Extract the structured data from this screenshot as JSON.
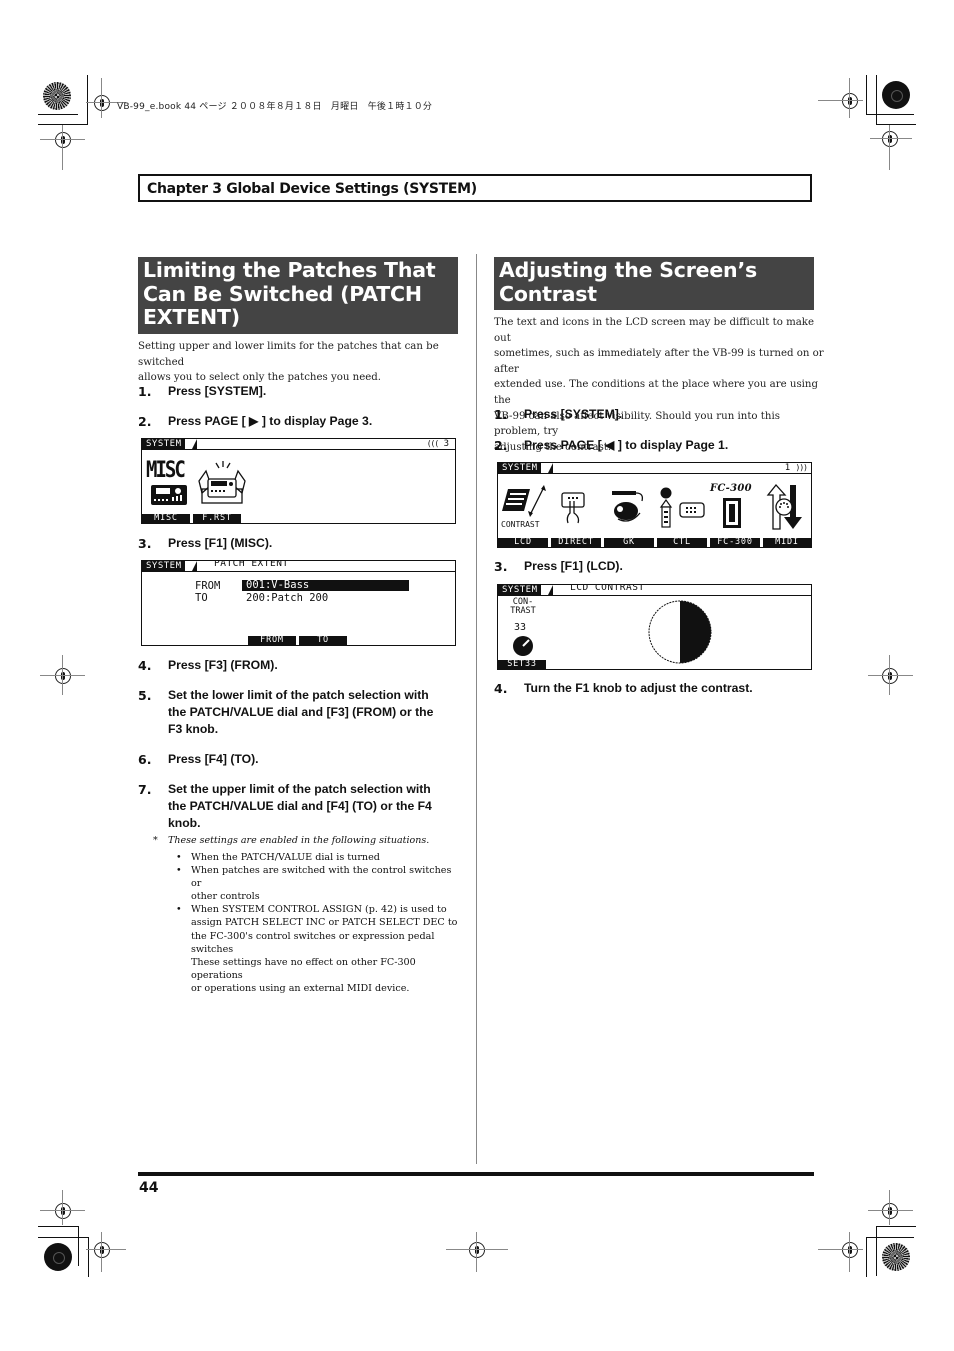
{
  "print_header": "VB-99_e.book  44 ページ  ２００８年８月１８日　月曜日　午後１時１０分",
  "chapter": {
    "title": "Chapter 3 Global Device Settings (SYSTEM)"
  },
  "left_section": {
    "title_lines": [
      "Limiting the Patches That",
      "Can Be Switched (PATCH",
      "EXTENT)"
    ],
    "intro_lines": [
      "Setting upper and lower limits for the patches that can be switched",
      "allows you to select only the patches you need."
    ],
    "steps": [
      {
        "num": "1.",
        "lines": [
          "Press [SYSTEM]."
        ]
      },
      {
        "num": "2.",
        "lines": [
          "Press PAGE [ ▶ ] to display Page 3."
        ]
      },
      {
        "num": "3.",
        "lines": [
          "Press [F1] (MISC)."
        ]
      },
      {
        "num": "4.",
        "lines": [
          "Press [F3] (FROM)."
        ]
      },
      {
        "num": "5.",
        "lines": [
          "Set the lower limit of the patch selection with",
          "the PATCH/VALUE dial and [F3] (FROM) or the",
          "F3 knob."
        ]
      },
      {
        "num": "6.",
        "lines": [
          "Press [F4] (TO)."
        ]
      },
      {
        "num": "7.",
        "lines": [
          "Set the upper limit of the patch selection with",
          "the PATCH/VALUE dial and [F4] (TO) or the F4",
          "knob."
        ]
      }
    ],
    "lcd_page3": {
      "system_label": "SYSTEM",
      "page_indicator": "3",
      "misc_big": "MISC",
      "tabs": [
        "MISC",
        "F.RST"
      ]
    },
    "lcd_patch_extent": {
      "system_label": "SYSTEM",
      "subtitle": "PATCH EXTENT",
      "from_label": "FROM",
      "from_value": "001:V-Bass",
      "to_label": "TO",
      "to_value": "200:Patch 200",
      "tabs": [
        "FROM",
        "TO"
      ]
    },
    "note": {
      "marker": "*",
      "heading": "These settings are enabled in the following situations.",
      "bullets": [
        [
          "When the PATCH/VALUE dial is turned"
        ],
        [
          "When patches are switched with the control switches or",
          "other controls"
        ],
        [
          "When SYSTEM CONTROL ASSIGN (p. 42) is used to",
          "assign PATCH SELECT INC or PATCH SELECT DEC to",
          "the FC-300's control switches or expression pedal",
          "switches",
          "These settings have no effect on other FC-300 operations",
          "or operations using an external MIDI device."
        ]
      ]
    }
  },
  "right_section": {
    "title_lines": [
      "Adjusting the Screen’s",
      "Contrast"
    ],
    "intro_lines": [
      "The text and icons in the LCD screen may be difficult to make out",
      "sometimes, such as immediately after the VB-99 is turned on or after",
      "extended use. The conditions at the place where you are using the",
      "VB-99 can also affect visibility. Should you run into this problem, try",
      "adjusting the contrast."
    ],
    "steps": [
      {
        "num": "1.",
        "lines": [
          "Press [SYSTEM]."
        ]
      },
      {
        "num": "2.",
        "lines": [
          "Press PAGE [ ◀ ] to display Page 1."
        ]
      },
      {
        "num": "3.",
        "lines": [
          "Press [F1] (LCD)."
        ]
      },
      {
        "num": "4.",
        "lines": [
          "Turn the F1 knob to adjust the contrast."
        ]
      }
    ],
    "lcd_page1": {
      "system_label": "SYSTEM",
      "page_indicator": "1",
      "contrast_icon_label": "CONTRAST",
      "fc300_label": "FC-300",
      "tabs": [
        "LCD",
        "DIRECT",
        "GK",
        "CTL",
        "FC-300",
        "MIDI"
      ]
    },
    "lcd_contrast": {
      "system_label": "SYSTEM",
      "subtitle": "LCD CONTRAST",
      "param_line1": "CON-",
      "param_line2": "TRAST",
      "value": "33",
      "tab": "SET33"
    }
  },
  "footer": {
    "page_number": "44"
  }
}
